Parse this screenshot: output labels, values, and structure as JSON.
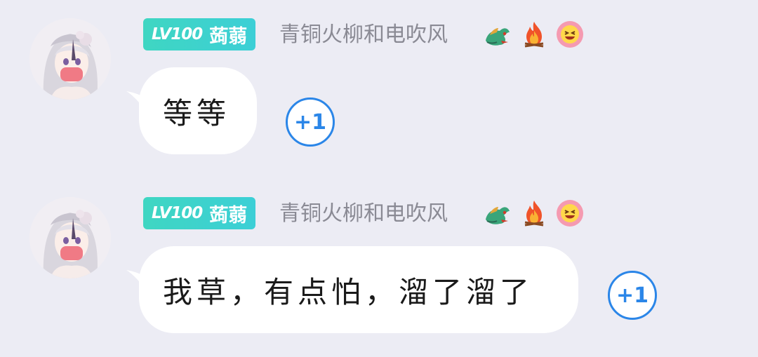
{
  "colors": {
    "background": "#ececf4",
    "bubble": "#ffffff",
    "badge_start": "#3fd6c2",
    "badge_end": "#3ccfd6",
    "username": "#8a8a94",
    "plus_one": "#2b86e8"
  },
  "messages": [
    {
      "avatar_icon": "anime-girl-avatar",
      "level_badge": {
        "level": "LV100",
        "name": "蒟蒻"
      },
      "username": "青铜火柳和电吹风",
      "decorations": [
        "dragon-icon",
        "fire-icon",
        "laughing-face-icon"
      ],
      "text": "等等",
      "plus_one_label": "+1"
    },
    {
      "avatar_icon": "anime-girl-avatar",
      "level_badge": {
        "level": "LV100",
        "name": "蒟蒻"
      },
      "username": "青铜火柳和电吹风",
      "decorations": [
        "dragon-icon",
        "fire-icon",
        "laughing-face-icon"
      ],
      "text": "我草，有点怕，溜了溜了",
      "plus_one_label": "+1"
    }
  ]
}
